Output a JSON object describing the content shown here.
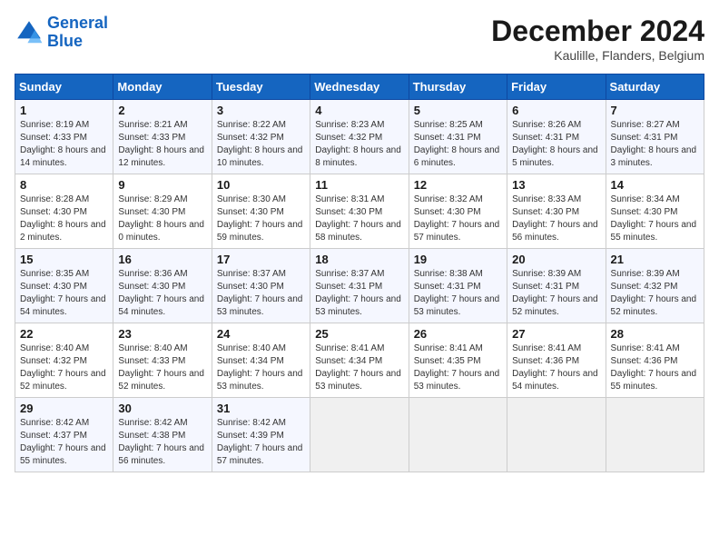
{
  "logo": {
    "line1": "General",
    "line2": "Blue"
  },
  "title": "December 2024",
  "location": "Kaulille, Flanders, Belgium",
  "days_of_week": [
    "Sunday",
    "Monday",
    "Tuesday",
    "Wednesday",
    "Thursday",
    "Friday",
    "Saturday"
  ],
  "weeks": [
    [
      {
        "day": "1",
        "sunrise": "8:19 AM",
        "sunset": "4:33 PM",
        "daylight": "8 hours and 14 minutes."
      },
      {
        "day": "2",
        "sunrise": "8:21 AM",
        "sunset": "4:33 PM",
        "daylight": "8 hours and 12 minutes."
      },
      {
        "day": "3",
        "sunrise": "8:22 AM",
        "sunset": "4:32 PM",
        "daylight": "8 hours and 10 minutes."
      },
      {
        "day": "4",
        "sunrise": "8:23 AM",
        "sunset": "4:32 PM",
        "daylight": "8 hours and 8 minutes."
      },
      {
        "day": "5",
        "sunrise": "8:25 AM",
        "sunset": "4:31 PM",
        "daylight": "8 hours and 6 minutes."
      },
      {
        "day": "6",
        "sunrise": "8:26 AM",
        "sunset": "4:31 PM",
        "daylight": "8 hours and 5 minutes."
      },
      {
        "day": "7",
        "sunrise": "8:27 AM",
        "sunset": "4:31 PM",
        "daylight": "8 hours and 3 minutes."
      }
    ],
    [
      {
        "day": "8",
        "sunrise": "8:28 AM",
        "sunset": "4:30 PM",
        "daylight": "8 hours and 2 minutes."
      },
      {
        "day": "9",
        "sunrise": "8:29 AM",
        "sunset": "4:30 PM",
        "daylight": "8 hours and 0 minutes."
      },
      {
        "day": "10",
        "sunrise": "8:30 AM",
        "sunset": "4:30 PM",
        "daylight": "7 hours and 59 minutes."
      },
      {
        "day": "11",
        "sunrise": "8:31 AM",
        "sunset": "4:30 PM",
        "daylight": "7 hours and 58 minutes."
      },
      {
        "day": "12",
        "sunrise": "8:32 AM",
        "sunset": "4:30 PM",
        "daylight": "7 hours and 57 minutes."
      },
      {
        "day": "13",
        "sunrise": "8:33 AM",
        "sunset": "4:30 PM",
        "daylight": "7 hours and 56 minutes."
      },
      {
        "day": "14",
        "sunrise": "8:34 AM",
        "sunset": "4:30 PM",
        "daylight": "7 hours and 55 minutes."
      }
    ],
    [
      {
        "day": "15",
        "sunrise": "8:35 AM",
        "sunset": "4:30 PM",
        "daylight": "7 hours and 54 minutes."
      },
      {
        "day": "16",
        "sunrise": "8:36 AM",
        "sunset": "4:30 PM",
        "daylight": "7 hours and 54 minutes."
      },
      {
        "day": "17",
        "sunrise": "8:37 AM",
        "sunset": "4:30 PM",
        "daylight": "7 hours and 53 minutes."
      },
      {
        "day": "18",
        "sunrise": "8:37 AM",
        "sunset": "4:31 PM",
        "daylight": "7 hours and 53 minutes."
      },
      {
        "day": "19",
        "sunrise": "8:38 AM",
        "sunset": "4:31 PM",
        "daylight": "7 hours and 53 minutes."
      },
      {
        "day": "20",
        "sunrise": "8:39 AM",
        "sunset": "4:31 PM",
        "daylight": "7 hours and 52 minutes."
      },
      {
        "day": "21",
        "sunrise": "8:39 AM",
        "sunset": "4:32 PM",
        "daylight": "7 hours and 52 minutes."
      }
    ],
    [
      {
        "day": "22",
        "sunrise": "8:40 AM",
        "sunset": "4:32 PM",
        "daylight": "7 hours and 52 minutes."
      },
      {
        "day": "23",
        "sunrise": "8:40 AM",
        "sunset": "4:33 PM",
        "daylight": "7 hours and 52 minutes."
      },
      {
        "day": "24",
        "sunrise": "8:40 AM",
        "sunset": "4:34 PM",
        "daylight": "7 hours and 53 minutes."
      },
      {
        "day": "25",
        "sunrise": "8:41 AM",
        "sunset": "4:34 PM",
        "daylight": "7 hours and 53 minutes."
      },
      {
        "day": "26",
        "sunrise": "8:41 AM",
        "sunset": "4:35 PM",
        "daylight": "7 hours and 53 minutes."
      },
      {
        "day": "27",
        "sunrise": "8:41 AM",
        "sunset": "4:36 PM",
        "daylight": "7 hours and 54 minutes."
      },
      {
        "day": "28",
        "sunrise": "8:41 AM",
        "sunset": "4:36 PM",
        "daylight": "7 hours and 55 minutes."
      }
    ],
    [
      {
        "day": "29",
        "sunrise": "8:42 AM",
        "sunset": "4:37 PM",
        "daylight": "7 hours and 55 minutes."
      },
      {
        "day": "30",
        "sunrise": "8:42 AM",
        "sunset": "4:38 PM",
        "daylight": "7 hours and 56 minutes."
      },
      {
        "day": "31",
        "sunrise": "8:42 AM",
        "sunset": "4:39 PM",
        "daylight": "7 hours and 57 minutes."
      },
      null,
      null,
      null,
      null
    ]
  ]
}
